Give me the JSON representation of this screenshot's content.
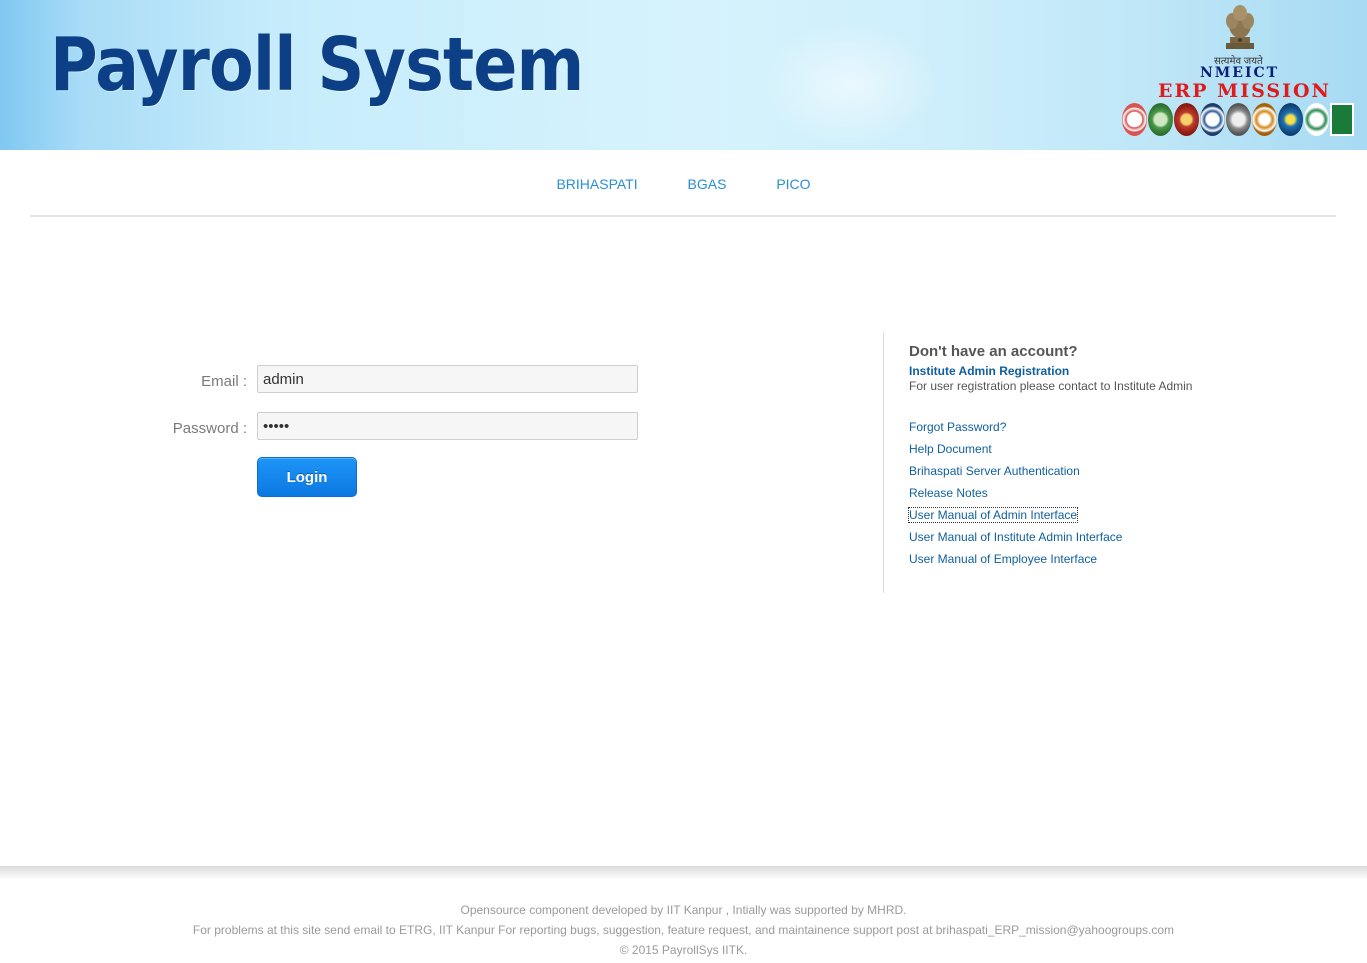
{
  "header": {
    "title": "Payroll System",
    "emblem_motto": "सत्यमेव जयते",
    "org_line1": "NMEICT",
    "org_line2": "ERP MISSION",
    "emblem_icon": "ashoka-emblem-icon",
    "partner_logo_colors": [
      "#d9534f",
      "#4a9a4a",
      "#c0392b",
      "#2c5d9b",
      "#8a8a8a",
      "#d4891d",
      "#1f6fb2",
      "#2e8b57",
      "#1a7a3a"
    ]
  },
  "nav": {
    "items": [
      {
        "label": "BRIHASPATI"
      },
      {
        "label": "BGAS"
      },
      {
        "label": "PICO"
      }
    ]
  },
  "login": {
    "email_label": "Email :",
    "email_value": "admin",
    "password_label": "Password :",
    "password_value": "admin",
    "login_label": "Login"
  },
  "side": {
    "heading": "Don't have an account?",
    "registration_link": "Institute Admin Registration",
    "registration_note": "For user registration please contact to Institute Admin",
    "links": [
      {
        "label": "Forgot Password?"
      },
      {
        "label": "Help Document"
      },
      {
        "label": "Brihaspati Server Authentication"
      },
      {
        "label": "Release Notes"
      },
      {
        "label": "User Manual of Admin Interface"
      },
      {
        "label": "User Manual of Institute Admin Interface"
      },
      {
        "label": "User Manual of Employee Interface"
      }
    ]
  },
  "footer": {
    "line1": "Opensource component developed by IIT Kanpur , Intially was supported by MHRD.",
    "line2": "For problems at this site send email to ETRG, IIT Kanpur For reporting bugs, suggestion, feature request, and maintainence support post at brihaspati_ERP_mission@yahoogroups.com",
    "line3": "© 2015 PayrollSys IITK."
  },
  "colors": {
    "title": "#0d3f86",
    "link": "#0f5f9f",
    "nav_link": "#2a8fd6",
    "button": "#1e95f7"
  }
}
